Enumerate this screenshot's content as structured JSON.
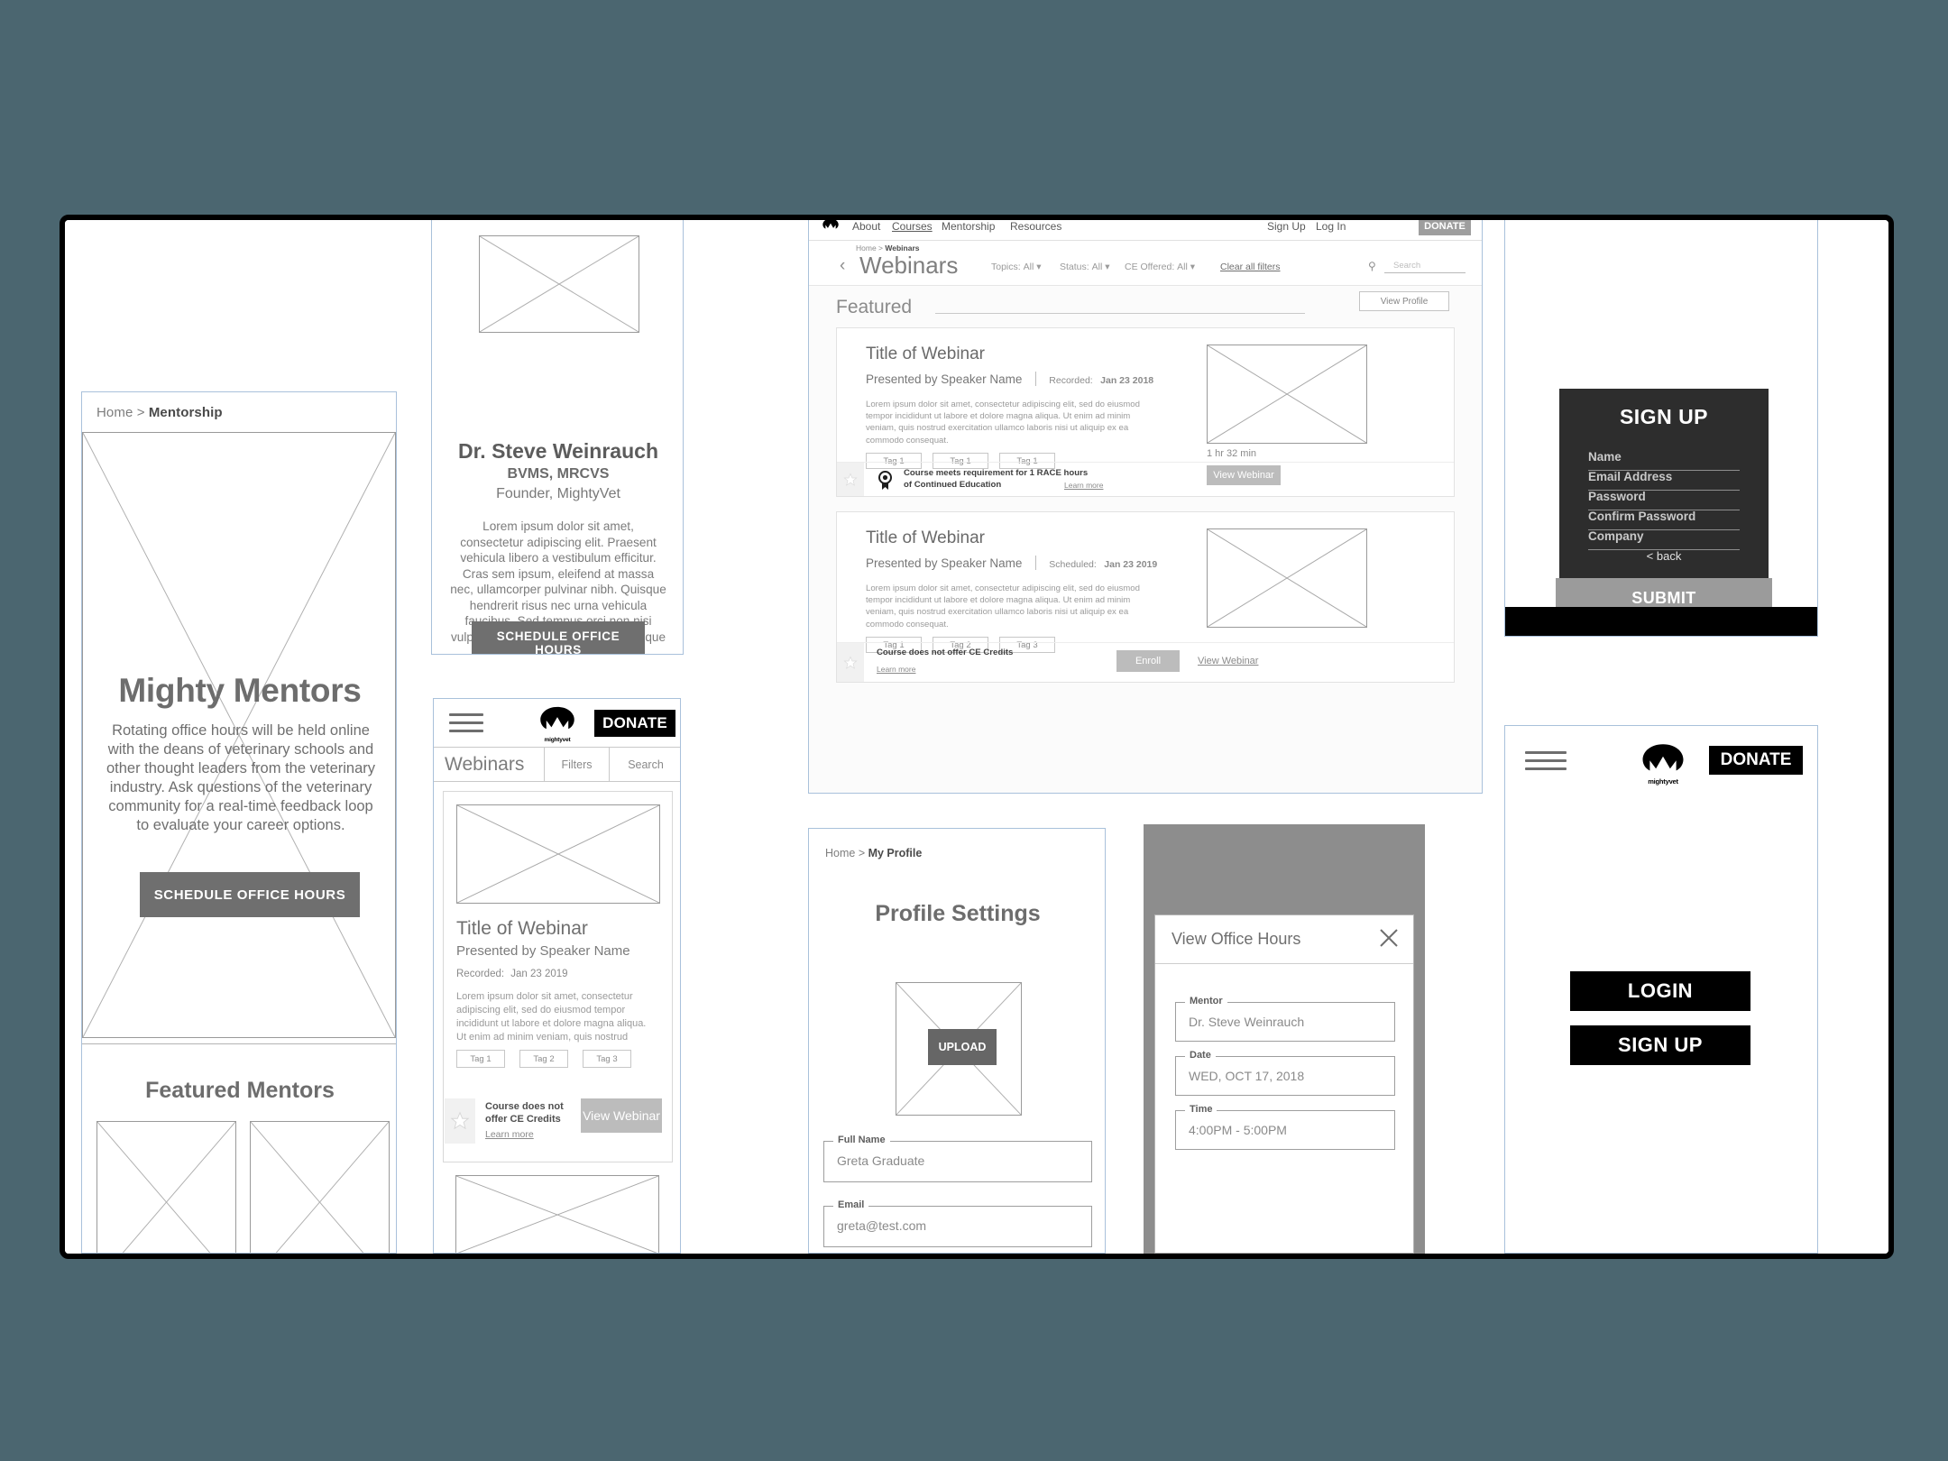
{
  "mentorship_page": {
    "breadcrumb_home": "Home",
    "breadcrumb_sep": " > ",
    "breadcrumb_current": "Mentorship",
    "title": "Mighty Mentors",
    "body": "Rotating office hours will be held online with the deans of veterinary schools and other thought leaders from the veterinary industry. Ask questions of the veterinary community for a real-time feedback loop to evaluate your career options.",
    "cta_label": "SCHEDULE OFFICE HOURS",
    "featured_title": "Featured Mentors"
  },
  "mentor_bio": {
    "name": "Dr. Steve Weinrauch",
    "credentials": "BVMS, MRCVS",
    "role": "Founder, MightyVet",
    "bio": "Lorem ipsum dolor sit amet, consectetur adipiscing elit. Praesent vehicula libero a vestibulum efficitur. Cras sem ipsum, eleifend at massa nec, ullamcorper pulvinar nibh. Quisque hendrerit risus nec urna vehicula faucibus. Sed tempus orci non nisi vulputate hendrerit. Orci varius natoque penatibus et",
    "cta_label": "SCHEDULE OFFICE HOURS"
  },
  "mobile_webinars": {
    "logo_text": "mightyvet",
    "donate_label": "DONATE",
    "section_label": "Webinars",
    "filters_label": "Filters",
    "search_label": "Search",
    "card": {
      "title": "Title of Webinar",
      "speaker": "Presented by Speaker Name",
      "meta_label": "Recorded:",
      "meta_value": "Jan 23 2019",
      "description": "Lorem ipsum dolor sit amet, consectetur adipiscing elit, sed do eiusmod tempor incididunt ut labore et dolore magna aliqua. Ut enim ad minim veniam, quis nostrud",
      "tags": [
        "Tag 1",
        "Tag 2",
        "Tag 3"
      ],
      "ce_note_line1": "Course does not",
      "ce_note_line2": "offer CE Credits",
      "learn_more": "Learn more",
      "action_label": "View Webinar"
    }
  },
  "desktop_webinars": {
    "nav": [
      "About",
      "Courses",
      "Mentorship",
      "Resources"
    ],
    "nav_active": "Courses",
    "auth": [
      "Sign Up",
      "Log In"
    ],
    "donate_label": "DONATE",
    "breadcrumb_home": "Home",
    "breadcrumb_sep": " > ",
    "breadcrumb_current": "Webinars",
    "back_glyph": "‹",
    "page_title": "Webinars",
    "filters": [
      {
        "label": "Topics:",
        "value": "All"
      },
      {
        "label": "Status:",
        "value": "All"
      },
      {
        "label": "CE Offered:",
        "value": "All"
      }
    ],
    "clear_filters": "Clear all filters",
    "search_placeholder": "Search",
    "featured_label": "Featured",
    "view_profile_label": "View Profile",
    "cards": [
      {
        "title": "Title of Webinar",
        "speaker": "Presented by Speaker Name",
        "meta_label": "Recorded:",
        "meta_value": "Jan 23 2018",
        "description": "Lorem ipsum dolor sit amet, consectetur adipiscing elit, sed do eiusmod tempor incididunt ut labore et dolore magna aliqua. Ut enim ad minim veniam, quis nostrud exercitation ullamco laboris nisi ut aliquip ex ea commodo consequat.",
        "tags": [
          "Tag 1",
          "Tag 1",
          "Tag 1"
        ],
        "ce_line1": "Course meets requirement for 1 RACE hours",
        "ce_line2": "of Continued Education",
        "learn_more": "Learn more",
        "duration": "1 hr 32 min",
        "primary_action": "View Webinar",
        "secondary_action": ""
      },
      {
        "title": "Title of Webinar",
        "speaker": "Presented by Speaker Name",
        "meta_label": "Scheduled:",
        "meta_value": "Jan 23 2019",
        "description": "Lorem ipsum dolor sit amet, consectetur adipiscing elit, sed do eiusmod tempor incididunt ut labore et dolore magna aliqua. Ut enim ad minim veniam, quis nostrud exercitation ullamco laboris nisi ut aliquip ex ea commodo consequat.",
        "tags": [
          "Tag 1",
          "Tag 2",
          "Tag 3"
        ],
        "ce_line1": "Course does not offer CE Credits",
        "ce_line2": "",
        "learn_more": "Learn more",
        "duration": "",
        "primary_action": "Enroll",
        "secondary_action": "View Webinar"
      }
    ]
  },
  "profile_settings": {
    "breadcrumb_home": "Home",
    "breadcrumb_sep": " > ",
    "breadcrumb_current": "My Profile",
    "title": "Profile Settings",
    "upload_label": "UPLOAD",
    "fields": [
      {
        "label": "Full Name",
        "value": "Greta Graduate"
      },
      {
        "label": "Email",
        "value": "greta@test.com"
      }
    ]
  },
  "office_hours_modal": {
    "title": "View Office Hours",
    "close_icon": "close-icon",
    "fields": [
      {
        "label": "Mentor",
        "value": "Dr. Steve Weinrauch"
      },
      {
        "label": "Date",
        "value": "WED, OCT 17, 2018"
      },
      {
        "label": "Time",
        "value": "4:00PM - 5:00PM"
      }
    ]
  },
  "signup_form": {
    "title": "SIGN UP",
    "fields": [
      "Name",
      "Email Address",
      "Password",
      "Confirm Password",
      "Company"
    ],
    "back_label": "< back",
    "submit_label": "SUBMIT"
  },
  "mobile_login": {
    "logo_text": "mightyvet",
    "donate_label": "DONATE",
    "login_label": "LOGIN",
    "signup_label": "SIGN UP"
  },
  "colors": {
    "page_background": "#4b6670",
    "canvas": "#ffffff",
    "panel_border": "#a9c1db",
    "accent_dark": "#2d2d2d",
    "grey_button": "#6f6f6f",
    "light_grey_button": "#bcbcbc",
    "black": "#000000"
  }
}
